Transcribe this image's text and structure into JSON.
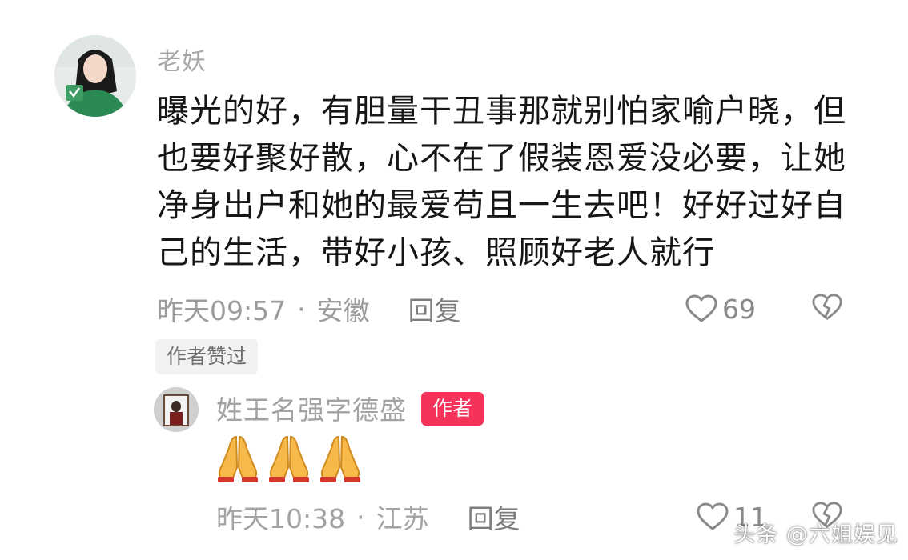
{
  "comment": {
    "username": "老妖",
    "text": "曝光的好，有胆量干丑事那就别怕家喻户晓，但也要好聚好散，心不在了假装恩爱没必要，让她净身出户和她的最爱苟且一生去吧！好好过好自己的生活，带好小孩、照顾好老人就行",
    "time": "昨天09:57",
    "separator": "·",
    "location": "安徽",
    "reply_label": "回复",
    "like_count": "69",
    "author_liked": "作者赞过"
  },
  "reply": {
    "username": "姓王名强字德盛",
    "badge": "作者",
    "emoji_count": 3,
    "time": "昨天10:38",
    "separator": "·",
    "location": "江苏",
    "reply_label": "回复",
    "like_count": "11"
  },
  "watermark": "头条 @六姐娱见",
  "icons": {
    "like": "heart-icon",
    "dislike": "broken-heart-icon",
    "emoji": "folded-hands-icon"
  },
  "colors": {
    "badge": "#f4325a",
    "text": "#161616",
    "meta": "#9c9c9c"
  }
}
